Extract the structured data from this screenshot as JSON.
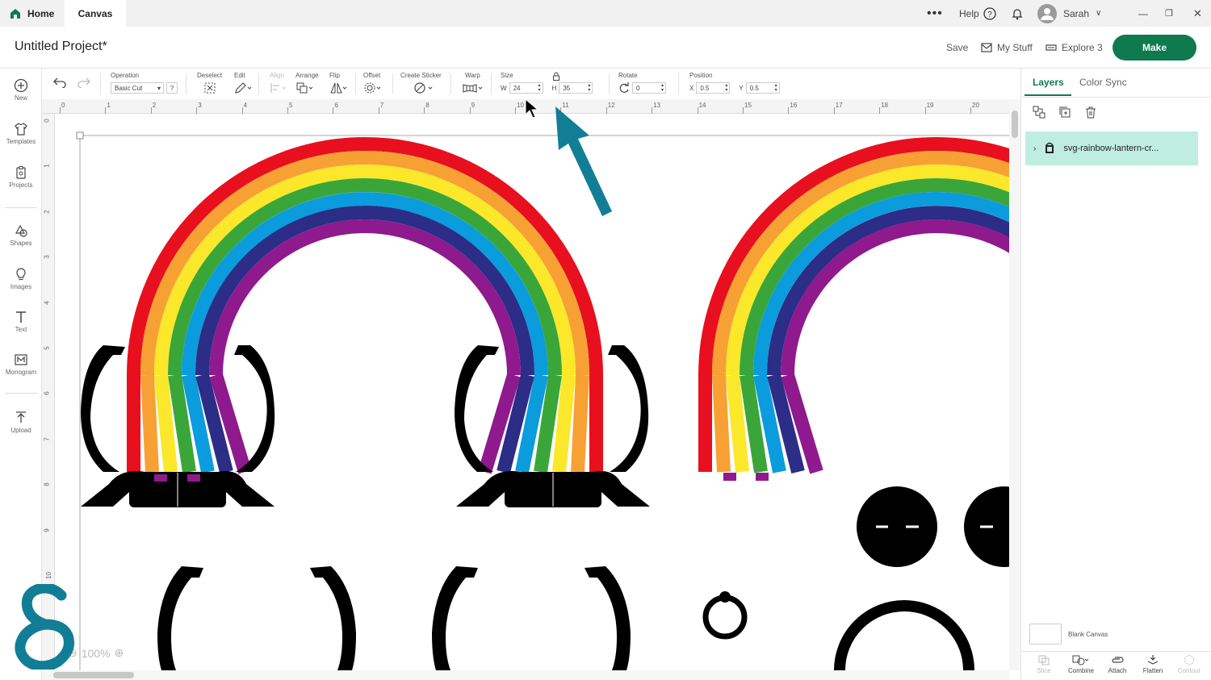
{
  "titlebar": {
    "home_label": "Home",
    "canvas_label": "Canvas",
    "help_label": "Help",
    "user_name": "Sarah"
  },
  "project": {
    "title": "Untitled Project*",
    "save_label": "Save",
    "mystuff_label": "My Stuff",
    "machine_label": "Explore 3",
    "make_label": "Make"
  },
  "sidebar": {
    "items": [
      {
        "label": "New",
        "icon": "plus-circle-icon"
      },
      {
        "label": "Templates",
        "icon": "shirt-icon"
      },
      {
        "label": "Projects",
        "icon": "clipboard-icon"
      },
      {
        "label": "Shapes",
        "icon": "shapes-icon"
      },
      {
        "label": "Images",
        "icon": "bulb-icon"
      },
      {
        "label": "Text",
        "icon": "text-icon"
      },
      {
        "label": "Monogram",
        "icon": "monogram-icon"
      },
      {
        "label": "Upload",
        "icon": "upload-icon"
      }
    ]
  },
  "toolbar": {
    "operation_label": "Operation",
    "operation_value": "Basic Cut",
    "help_q": "?",
    "deselect_label": "Deselect",
    "edit_label": "Edit",
    "align_label": "Align",
    "arrange_label": "Arrange",
    "flip_label": "Flip",
    "offset_label": "Offset",
    "sticker_label": "Create Sticker",
    "warp_label": "Warp",
    "size_label": "Size",
    "w_label": "W",
    "w_value": "24",
    "h_label": "H",
    "h_value": "35",
    "rotate_label": "Rotate",
    "rotate_value": "0",
    "position_label": "Position",
    "x_label": "X",
    "x_value": "0.5",
    "y_label": "Y",
    "y_value": "0.5"
  },
  "ruler": {
    "top": [
      "0",
      "1",
      "2",
      "3",
      "4",
      "5",
      "6",
      "7",
      "8",
      "9",
      "10",
      "11",
      "12",
      "13",
      "14",
      "15",
      "16",
      "17",
      "18",
      "19",
      "20"
    ],
    "left": [
      "0",
      "1",
      "2",
      "3",
      "4",
      "5",
      "6",
      "7",
      "8",
      "9",
      "10"
    ]
  },
  "panel": {
    "layers_tab": "Layers",
    "colorsync_tab": "Color Sync",
    "layer_name": "svg-rainbow-lantern-cr...",
    "blank_canvas_label": "Blank Canvas",
    "actions": [
      "Slice",
      "Combine",
      "Attach",
      "Flatten",
      "Contour"
    ]
  },
  "zoom": {
    "value": "100%"
  },
  "colors": {
    "accent": "#0f7a4f",
    "rainbow": [
      "#e8101e",
      "#f7a134",
      "#fbe82a",
      "#3aa63a",
      "#0a9cdc",
      "#2b2d86",
      "#8e1a8e"
    ],
    "arrow": "#127e96",
    "logo": "#127e96"
  }
}
